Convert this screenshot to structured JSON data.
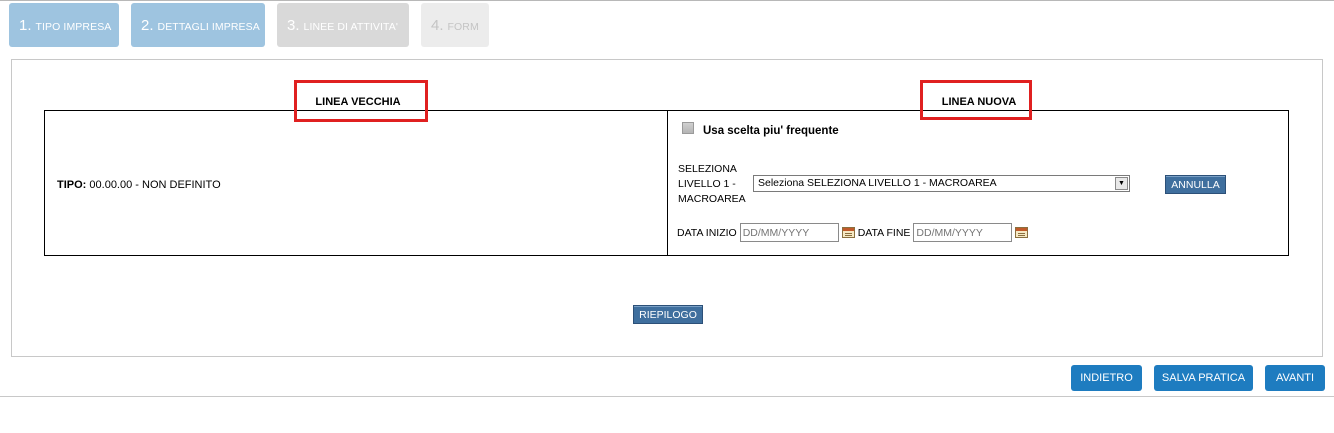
{
  "wizard": {
    "steps": [
      {
        "num": "1.",
        "label": "Tipo impresa",
        "state": "completed"
      },
      {
        "num": "2.",
        "label": "Dettagli impresa",
        "state": "completed"
      },
      {
        "num": "3.",
        "label": "Linee di attivita'",
        "state": "current"
      },
      {
        "num": "4.",
        "label": "Form",
        "state": "disabled"
      }
    ]
  },
  "panel": {
    "old_line": {
      "header": "LINEA VECCHIA",
      "tipo_label": "TIPO:",
      "tipo_value": "00.00.00 - NON DEFINITO"
    },
    "new_line": {
      "header": "LINEA NUOVA",
      "checkbox_label": "Usa scelta piu' frequente",
      "select_label": "SELEZIONA LIVELLO 1 - MACROAREA",
      "select_value": "Seleziona SELEZIONA LIVELLO 1 - MACROAREA",
      "annulla_label": "ANNULLA",
      "date_start_label": "DATA INIZIO",
      "date_start_placeholder": "DD/MM/YYYY",
      "date_end_label": "DATA FINE",
      "date_end_placeholder": "DD/MM/YYYY"
    },
    "riepilogo_label": "RIEPILOGO"
  },
  "footer": {
    "back_label": "INDIETRO",
    "save_label": "SALVA PRATICA",
    "next_label": "AVANTI"
  },
  "colors": {
    "step_done": "#9ec4e0",
    "step_current": "#d9d9d9",
    "step_disabled": "#ececec",
    "primary_button": "#1e7cc0",
    "small_button": "#3f6f9e",
    "highlight": "#e02020"
  }
}
